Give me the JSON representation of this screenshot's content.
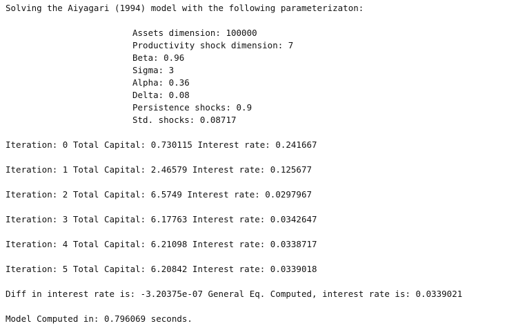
{
  "console": {
    "header": "Solving the Aiyagari (1994) model with the following parameterizaton:",
    "params": [
      "Assets dimension: 100000",
      "Productivity shock dimension: 7",
      "Beta: 0.96",
      "Sigma: 3",
      "Alpha: 0.36",
      "Delta: 0.08",
      "Persistence shocks: 0.9",
      "Std. shocks: 0.08717"
    ],
    "iterations": [
      "Iteration: 0 Total Capital: 0.730115 Interest rate: 0.241667",
      "Iteration: 1 Total Capital: 2.46579 Interest rate: 0.125677",
      "Iteration: 2 Total Capital: 6.5749 Interest rate: 0.0297967",
      "Iteration: 3 Total Capital: 6.17763 Interest rate: 0.0342647",
      "Iteration: 4 Total Capital: 6.21098 Interest rate: 0.0338717",
      "Iteration: 5 Total Capital: 6.20842 Interest rate: 0.0339018"
    ],
    "diff_line": "Diff in interest rate is: -3.20375e-07 General Eq. Computed, interest rate is: 0.0339021",
    "time_line": "Model Computed in: 0.796069 seconds."
  }
}
